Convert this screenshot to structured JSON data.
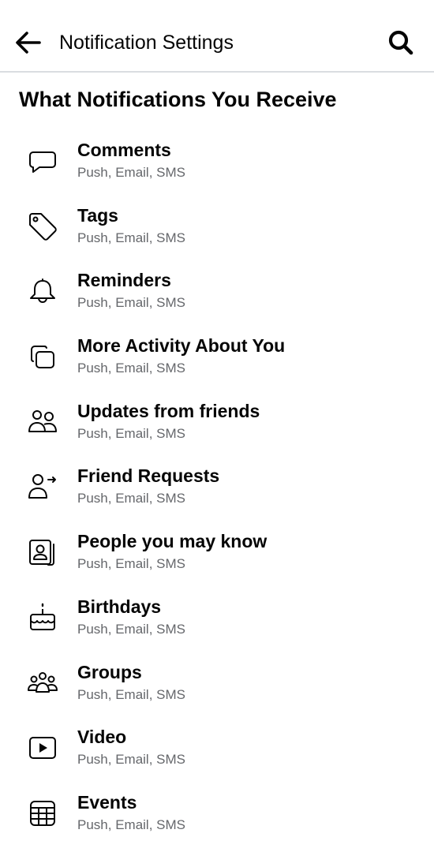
{
  "header": {
    "title": "Notification Settings",
    "back_icon": "arrow-left-icon",
    "search_icon": "search-icon"
  },
  "section": {
    "title": "What Notifications You Receive"
  },
  "items": [
    {
      "label": "Comments",
      "sub": "Push, Email, SMS",
      "icon": "comment-icon"
    },
    {
      "label": "Tags",
      "sub": "Push, Email, SMS",
      "icon": "tag-icon"
    },
    {
      "label": "Reminders",
      "sub": "Push, Email, SMS",
      "icon": "bell-icon"
    },
    {
      "label": "More Activity About You",
      "sub": "Push, Email, SMS",
      "icon": "stacked-squares-icon"
    },
    {
      "label": "Updates from friends",
      "sub": "Push, Email, SMS",
      "icon": "friends-icon"
    },
    {
      "label": "Friend Requests",
      "sub": "Push, Email, SMS",
      "icon": "person-arrow-icon"
    },
    {
      "label": "People you may know",
      "sub": "Push, Email, SMS",
      "icon": "contact-card-icon"
    },
    {
      "label": "Birthdays",
      "sub": "Push, Email, SMS",
      "icon": "cake-icon"
    },
    {
      "label": "Groups",
      "sub": "Push, Email, SMS",
      "icon": "group-icon"
    },
    {
      "label": "Video",
      "sub": "Push, Email, SMS",
      "icon": "video-play-icon"
    },
    {
      "label": "Events",
      "sub": "Push, Email, SMS",
      "icon": "calendar-icon"
    }
  ],
  "colors": {
    "text_primary": "#050505",
    "text_secondary": "#65676b",
    "divider": "#dadde1"
  }
}
